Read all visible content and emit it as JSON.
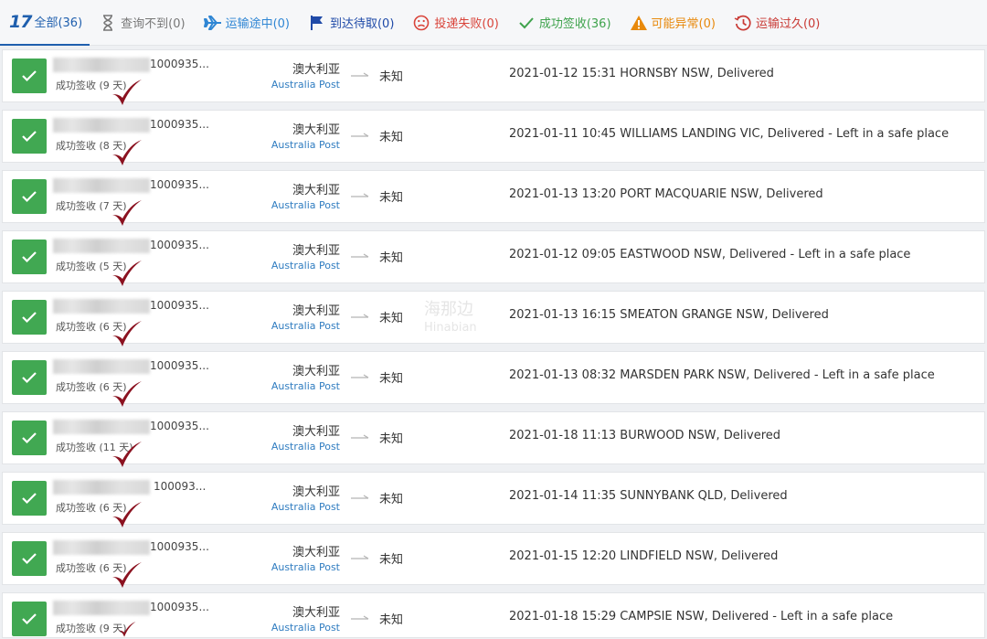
{
  "tabs": [
    {
      "label": "全部(36)",
      "icon": "logo-17-icon",
      "color": "#1f5fae",
      "active": true
    },
    {
      "label": "查询不到(0)",
      "icon": "hourglass-icon",
      "color": "#777777"
    },
    {
      "label": "运输途中(0)",
      "icon": "airplane-icon",
      "color": "#2f86d4"
    },
    {
      "label": "到达待取(0)",
      "icon": "flag-icon",
      "color": "#1f4aa8"
    },
    {
      "label": "投递失败(0)",
      "icon": "sad-face-icon",
      "color": "#d9443a"
    },
    {
      "label": "成功签收(36)",
      "icon": "check-icon",
      "color": "#3fa34d"
    },
    {
      "label": "可能异常(0)",
      "icon": "warning-icon",
      "color": "#e8890c"
    },
    {
      "label": "运输过久(0)",
      "icon": "clock-icon",
      "color": "#c93a35"
    }
  ],
  "logo_text": "17",
  "colors": {
    "success_green": "#41a852",
    "tick_red": "#8b1220",
    "carrier_blue": "#2f7cc0"
  },
  "rows": [
    {
      "number": "1000935...",
      "status": "成功签收 (9 天)",
      "country": "澳大利亚",
      "carrier": "Australia Post",
      "destination": "未知",
      "datetime": "2021-01-12 15:31",
      "event": "HORNSBY NSW, Delivered"
    },
    {
      "number": "1000935...",
      "status": "成功签收 (8 天)",
      "country": "澳大利亚",
      "carrier": "Australia Post",
      "destination": "未知",
      "datetime": "2021-01-11 10:45",
      "event": "WILLIAMS LANDING VIC, Delivered - Left in a safe place"
    },
    {
      "number": "1000935...",
      "status": "成功签收 (7 天)",
      "country": "澳大利亚",
      "carrier": "Australia Post",
      "destination": "未知",
      "datetime": "2021-01-13 13:20",
      "event": "PORT MACQUARIE NSW, Delivered"
    },
    {
      "number": "1000935...",
      "status": "成功签收 (5 天)",
      "country": "澳大利亚",
      "carrier": "Australia Post",
      "destination": "未知",
      "datetime": "2021-01-12 09:05",
      "event": "EASTWOOD NSW, Delivered - Left in a safe place"
    },
    {
      "number": "1000935...",
      "status": "成功签收 (6 天)",
      "country": "澳大利亚",
      "carrier": "Australia Post",
      "destination": "未知",
      "datetime": "2021-01-13 16:15",
      "event": "SMEATON GRANGE NSW, Delivered"
    },
    {
      "number": "1000935...",
      "status": "成功签收 (6 天)",
      "country": "澳大利亚",
      "carrier": "Australia Post",
      "destination": "未知",
      "datetime": "2021-01-13 08:32",
      "event": "MARSDEN PARK NSW, Delivered - Left in a safe place"
    },
    {
      "number": "1000935...",
      "status": "成功签收 (11 天)",
      "country": "澳大利亚",
      "carrier": "Australia Post",
      "destination": "未知",
      "datetime": "2021-01-18 11:13",
      "event": "BURWOOD NSW, Delivered"
    },
    {
      "number": "100093...",
      "status": "成功签收 (6 天)",
      "country": "澳大利亚",
      "carrier": "Australia Post",
      "destination": "未知",
      "datetime": "2021-01-14 11:35",
      "event": "SUNNYBANK QLD, Delivered"
    },
    {
      "number": "1000935...",
      "status": "成功签收 (6 天)",
      "country": "澳大利亚",
      "carrier": "Australia Post",
      "destination": "未知",
      "datetime": "2021-01-15 12:20",
      "event": "LINDFIELD NSW, Delivered"
    },
    {
      "number": "1000935...",
      "status": "成功签收 (9 天)",
      "country": "澳大利亚",
      "carrier": "Australia Post",
      "destination": "未知",
      "datetime": "2021-01-18 15:29",
      "event": "CAMPSIE NSW, Delivered - Left in a safe place"
    }
  ],
  "watermark": {
    "cn": "海那边",
    "en": "Hinabian"
  }
}
